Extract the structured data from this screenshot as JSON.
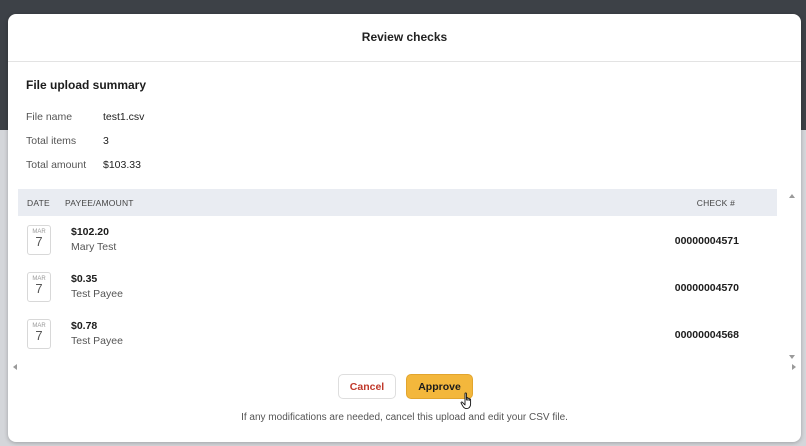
{
  "modal": {
    "title": "Review checks"
  },
  "summary": {
    "heading": "File upload summary",
    "file_name_label": "File name",
    "file_name": "test1.csv",
    "total_items_label": "Total items",
    "total_items": "3",
    "total_amount_label": "Total amount",
    "total_amount": "$103.33"
  },
  "table": {
    "headers": {
      "date": "DATE",
      "payee_amount": "PAYEE/AMOUNT",
      "check": "CHECK #"
    },
    "rows": [
      {
        "month": "MAR",
        "day": "7",
        "amount": "$102.20",
        "payee": "Mary Test",
        "check": "00000004571"
      },
      {
        "month": "MAR",
        "day": "7",
        "amount": "$0.35",
        "payee": "Test Payee",
        "check": "00000004570"
      },
      {
        "month": "MAR",
        "day": "7",
        "amount": "$0.78",
        "payee": "Test Payee",
        "check": "00000004568"
      }
    ]
  },
  "actions": {
    "cancel": "Cancel",
    "approve": "Approve"
  },
  "footer": {
    "note": "If any modifications are needed, cancel this upload and edit your CSV file."
  },
  "colors": {
    "approve": "#f3b73c",
    "cancel_text": "#c0392b",
    "table_header": "#e9ecf2"
  }
}
